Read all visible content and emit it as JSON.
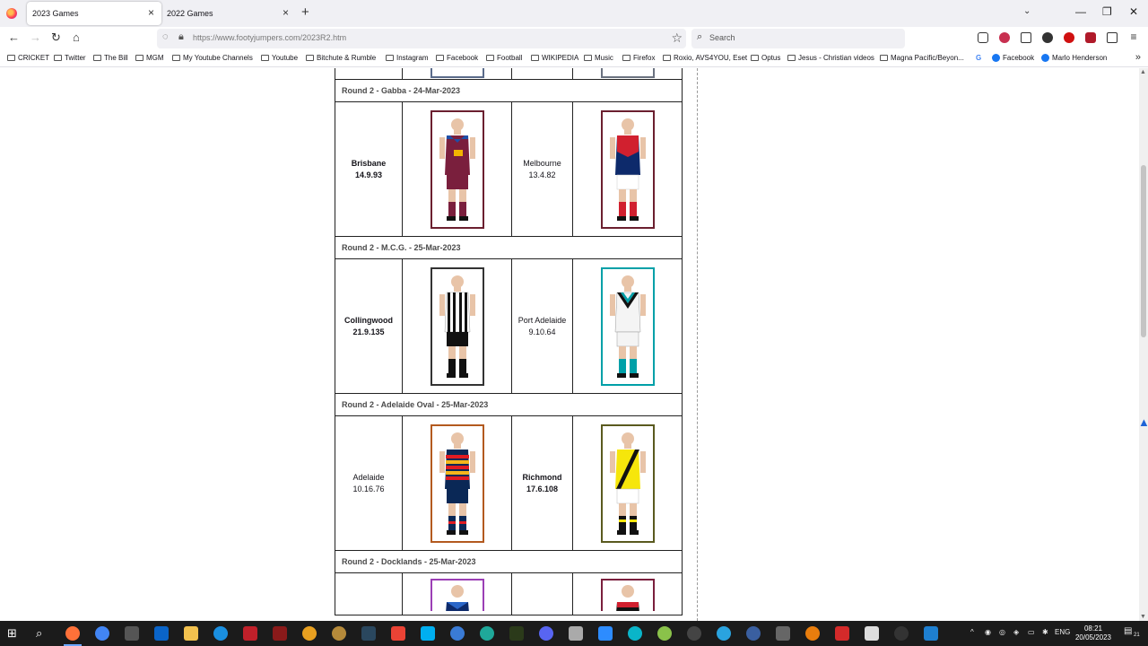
{
  "browser": {
    "tabs": [
      {
        "label": "2023 Games",
        "active": true
      },
      {
        "label": "2022 Games",
        "active": false
      }
    ],
    "url": "https://www.footyjumpers.com/2023R2.htm",
    "search_placeholder": "Search",
    "window_controls": {
      "minimize": "—",
      "maximize": "❐",
      "close": "✕"
    }
  },
  "bookmarks": [
    {
      "label": "CRICKET",
      "type": "folder"
    },
    {
      "label": "Twitter",
      "type": "folder"
    },
    {
      "label": "The Bill",
      "type": "folder"
    },
    {
      "label": "MGM",
      "type": "folder"
    },
    {
      "label": "My Youtube Channels",
      "type": "folder"
    },
    {
      "label": "Youtube",
      "type": "folder"
    },
    {
      "label": "Bitchute & Rumble",
      "type": "folder"
    },
    {
      "label": "Instagram",
      "type": "folder"
    },
    {
      "label": "Facebook",
      "type": "folder"
    },
    {
      "label": "Football",
      "type": "folder"
    },
    {
      "label": "WIKIPEDIA",
      "type": "folder"
    },
    {
      "label": "Music",
      "type": "folder"
    },
    {
      "label": "Firefox",
      "type": "folder"
    },
    {
      "label": "Roxio, AVS4YOU, Eset",
      "type": "folder"
    },
    {
      "label": "Optus",
      "type": "folder"
    },
    {
      "label": "Jesus - Christian videos",
      "type": "folder"
    },
    {
      "label": "Magna Pacific/Beyon...",
      "type": "folder"
    },
    {
      "label": "",
      "type": "google"
    },
    {
      "label": "Facebook",
      "type": "facebook"
    },
    {
      "label": "Marlo Henderson",
      "type": "facebook"
    }
  ],
  "games": [
    {
      "heading": "Round 2 - Gabba - 24-Mar-2023",
      "home": {
        "team": "Brisbane",
        "score": "14.9.93",
        "winner": true
      },
      "away": {
        "team": "Melbourne",
        "score": "13.4.82",
        "winner": false
      }
    },
    {
      "heading": "Round 2 - M.C.G. - 25-Mar-2023",
      "home": {
        "team": "Collingwood",
        "score": "21.9.135",
        "winner": true
      },
      "away": {
        "team": "Port Adelaide",
        "score": "9.10.64",
        "winner": false
      }
    },
    {
      "heading": "Round 2 - Adelaide Oval - 25-Mar-2023",
      "home": {
        "team": "Adelaide",
        "score": "10.16.76",
        "winner": false
      },
      "away": {
        "team": "Richmond",
        "score": "17.6.108",
        "winner": true
      }
    },
    {
      "heading": "Round 2 - Docklands - 25-Mar-2023"
    }
  ],
  "taskbar": {
    "tray": {
      "lang": "ENG",
      "time": "08:21",
      "date": "20/05/2023",
      "notifications": "21"
    }
  },
  "colors": {
    "brisbane_maroon": "#7a1f3d",
    "brisbane_gold": "#f2b400",
    "brisbane_blue": "#1e4fa8",
    "melbourne_navy": "#0d2a6b",
    "melbourne_red": "#d1202f",
    "collingwood_black": "#111111",
    "port_teal": "#00a0a8",
    "adelaide_navy": "#0a2856",
    "adelaide_red": "#e01b22",
    "adelaide_gold": "#f5b51c",
    "richmond_yellow": "#f6e60b",
    "richmond_black": "#111111"
  }
}
